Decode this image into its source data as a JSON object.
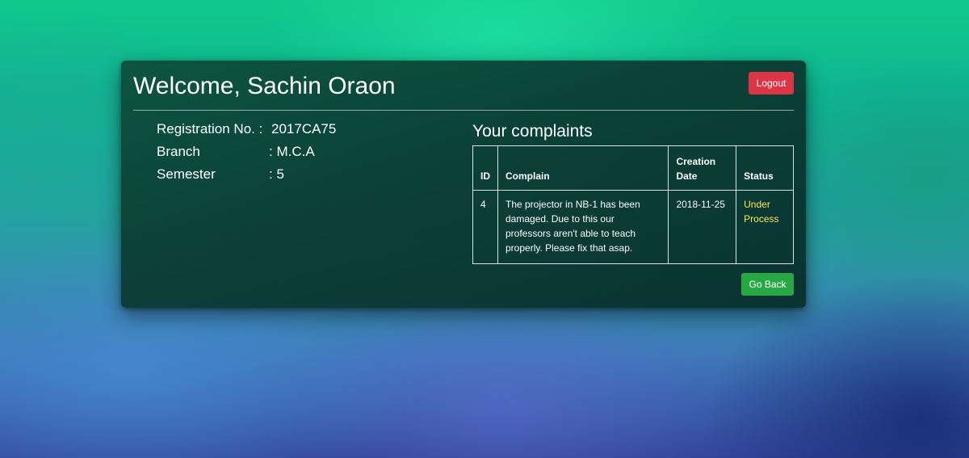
{
  "header": {
    "welcome_text": "Welcome, Sachin Oraon",
    "logout_label": "Logout"
  },
  "student": {
    "registration_label": "Registration No. :",
    "registration_value": "2017CA75",
    "branch_label": "Branch",
    "branch_value": ": M.C.A",
    "semester_label": "Semester",
    "semester_value": ": 5"
  },
  "complaints": {
    "title": "Your complaints",
    "columns": {
      "id": "ID",
      "complain": "Complain",
      "creation_date": "Creation Date",
      "status": "Status"
    },
    "rows": [
      {
        "id": "4",
        "complain": "The projector in NB-1 has been damaged. Due to this our professors aren't able to teach properly. Please fix that asap.",
        "creation_date": "2018-11-25",
        "status": "Under Process"
      }
    ]
  },
  "footer": {
    "go_back_label": "Go Back"
  },
  "colors": {
    "logout_button": "#dc3545",
    "go_back_button": "#28a745",
    "status_under_process": "#ffe74c",
    "card_background": "#0b3f35"
  }
}
